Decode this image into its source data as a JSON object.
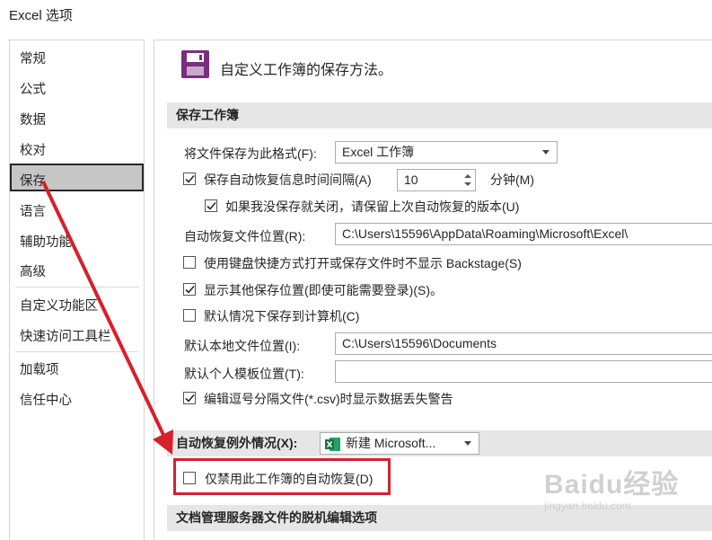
{
  "window": {
    "title": "Excel 选项"
  },
  "sidebar": {
    "items": [
      {
        "label": "常规"
      },
      {
        "label": "公式"
      },
      {
        "label": "数据"
      },
      {
        "label": "校对"
      },
      {
        "label": "保存",
        "selected": true
      },
      {
        "label": "语言"
      },
      {
        "label": "辅助功能"
      },
      {
        "label": "高级"
      },
      {
        "label": "自定义功能区"
      },
      {
        "label": "快速访问工具栏"
      },
      {
        "label": "加载项"
      },
      {
        "label": "信任中心"
      }
    ]
  },
  "header": {
    "text": "自定义工作簿的保存方法。",
    "icon": "floppy-disk-icon",
    "icon_color": "#7b2e7e"
  },
  "save_section": {
    "title": "保存工作簿",
    "format_label": "将文件保存为此格式(F):",
    "format_value": "Excel 工作簿",
    "autorecover_label": "保存自动恢复信息时间间隔(A)",
    "autorecover_checked": true,
    "autorecover_value": "10",
    "minutes_label": "分钟(M)",
    "keep_last_label": "如果我没保存就关闭，请保留上次自动恢复的版本(U)",
    "keep_last_checked": true,
    "autorecover_location_label": "自动恢复文件位置(R):",
    "autorecover_location_value": "C:\\Users\\15596\\AppData\\Roaming\\Microsoft\\Excel\\",
    "no_backstage_label": "使用键盘快捷方式打开或保存文件时不显示 Backstage(S)",
    "no_backstage_checked": false,
    "show_more_label": "显示其他保存位置(即使可能需要登录)(S)。",
    "show_more_checked": true,
    "save_to_computer_label": "默认情况下保存到计算机(C)",
    "save_to_computer_checked": false,
    "default_local_label": "默认本地文件位置(I):",
    "default_local_value": "C:\\Users\\15596\\Documents",
    "personal_templates_label": "默认个人模板位置(T):",
    "personal_templates_value": "",
    "csv_warning_label": "编辑逗号分隔文件(*.csv)时显示数据丢失警告",
    "csv_warning_checked": true
  },
  "exceptions_section": {
    "title": "自动恢复例外情况(X):",
    "workbook_value": "新建 Microsoft...",
    "disable_label": "仅禁用此工作簿的自动恢复(D)",
    "disable_checked": false
  },
  "offline_section": {
    "title": "文档管理服务器文件的脱机编辑选项"
  },
  "watermark": {
    "brand": "Baidu经验",
    "url": "jingyan.baidu.com"
  },
  "colors": {
    "annotation": "#d6202c",
    "excel_green": "#1f7244"
  }
}
